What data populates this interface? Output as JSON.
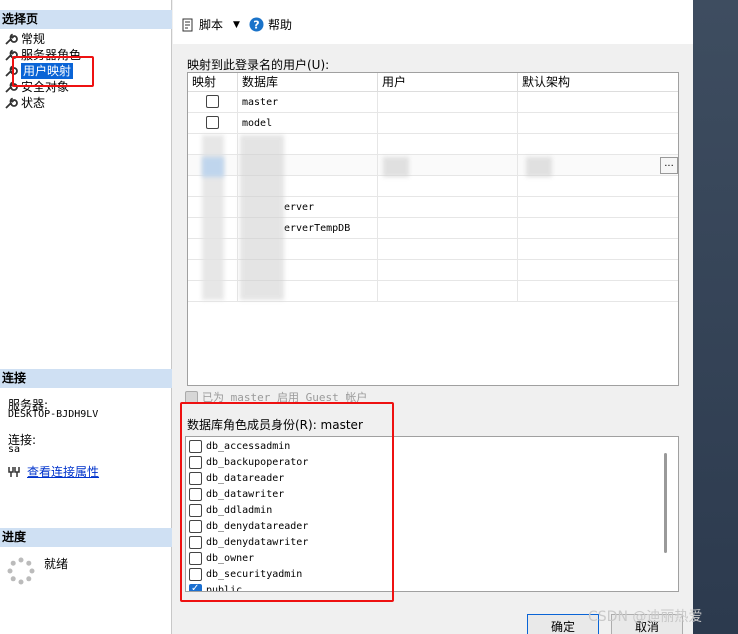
{
  "left": {
    "select_page_header": "选择页",
    "nav_items": [
      {
        "label": "常规"
      },
      {
        "label": "服务器角色"
      },
      {
        "label": "用户映射"
      },
      {
        "label": "安全对象"
      },
      {
        "label": "状态"
      }
    ],
    "connection_header": "连接",
    "server_label": "服务器:",
    "server_value": "DESKTOP-BJDH9LV",
    "connection_label": "连接:",
    "connection_value": "sa",
    "view_connection_props": "查看连接属性",
    "progress_header": "进度",
    "progress_status": "就绪"
  },
  "toolbar": {
    "script_label": "脚本",
    "help_label": "帮助"
  },
  "mapping": {
    "label": "映射到此登录名的用户(U):",
    "columns": [
      "映射",
      "数据库",
      "用户",
      "默认架构"
    ],
    "rows": [
      {
        "db": "master",
        "checked": false
      },
      {
        "db": "model",
        "checked": false
      },
      {
        "db": "",
        "checked": null
      },
      {
        "db": "",
        "checked": null
      },
      {
        "db": "",
        "checked": null
      },
      {
        "db": "erver",
        "checked": null
      },
      {
        "db": "erverTempDB",
        "checked": null
      },
      {
        "db": "",
        "checked": null
      },
      {
        "db": "",
        "checked": null
      },
      {
        "db": "",
        "checked": null
      }
    ],
    "ellipsis": "..."
  },
  "guest": {
    "label": "已为 master 启用 Guest 帐户"
  },
  "roles": {
    "label": "数据库角色成员身份(R): master",
    "items": [
      {
        "name": "db_accessadmin",
        "checked": false
      },
      {
        "name": "db_backupoperator",
        "checked": false
      },
      {
        "name": "db_datareader",
        "checked": false
      },
      {
        "name": "db_datawriter",
        "checked": false
      },
      {
        "name": "db_ddladmin",
        "checked": false
      },
      {
        "name": "db_denydatareader",
        "checked": false
      },
      {
        "name": "db_denydatawriter",
        "checked": false
      },
      {
        "name": "db_owner",
        "checked": false
      },
      {
        "name": "db_securityadmin",
        "checked": false
      },
      {
        "name": "public",
        "checked": true
      }
    ]
  },
  "buttons": {
    "ok": "确定",
    "cancel": "取消"
  },
  "watermark": "CSDN @迪丽热爱",
  "colors": {
    "accent": "#0a64d6",
    "section_header": "#cfe0f3",
    "highlight_box": "#e11111"
  }
}
